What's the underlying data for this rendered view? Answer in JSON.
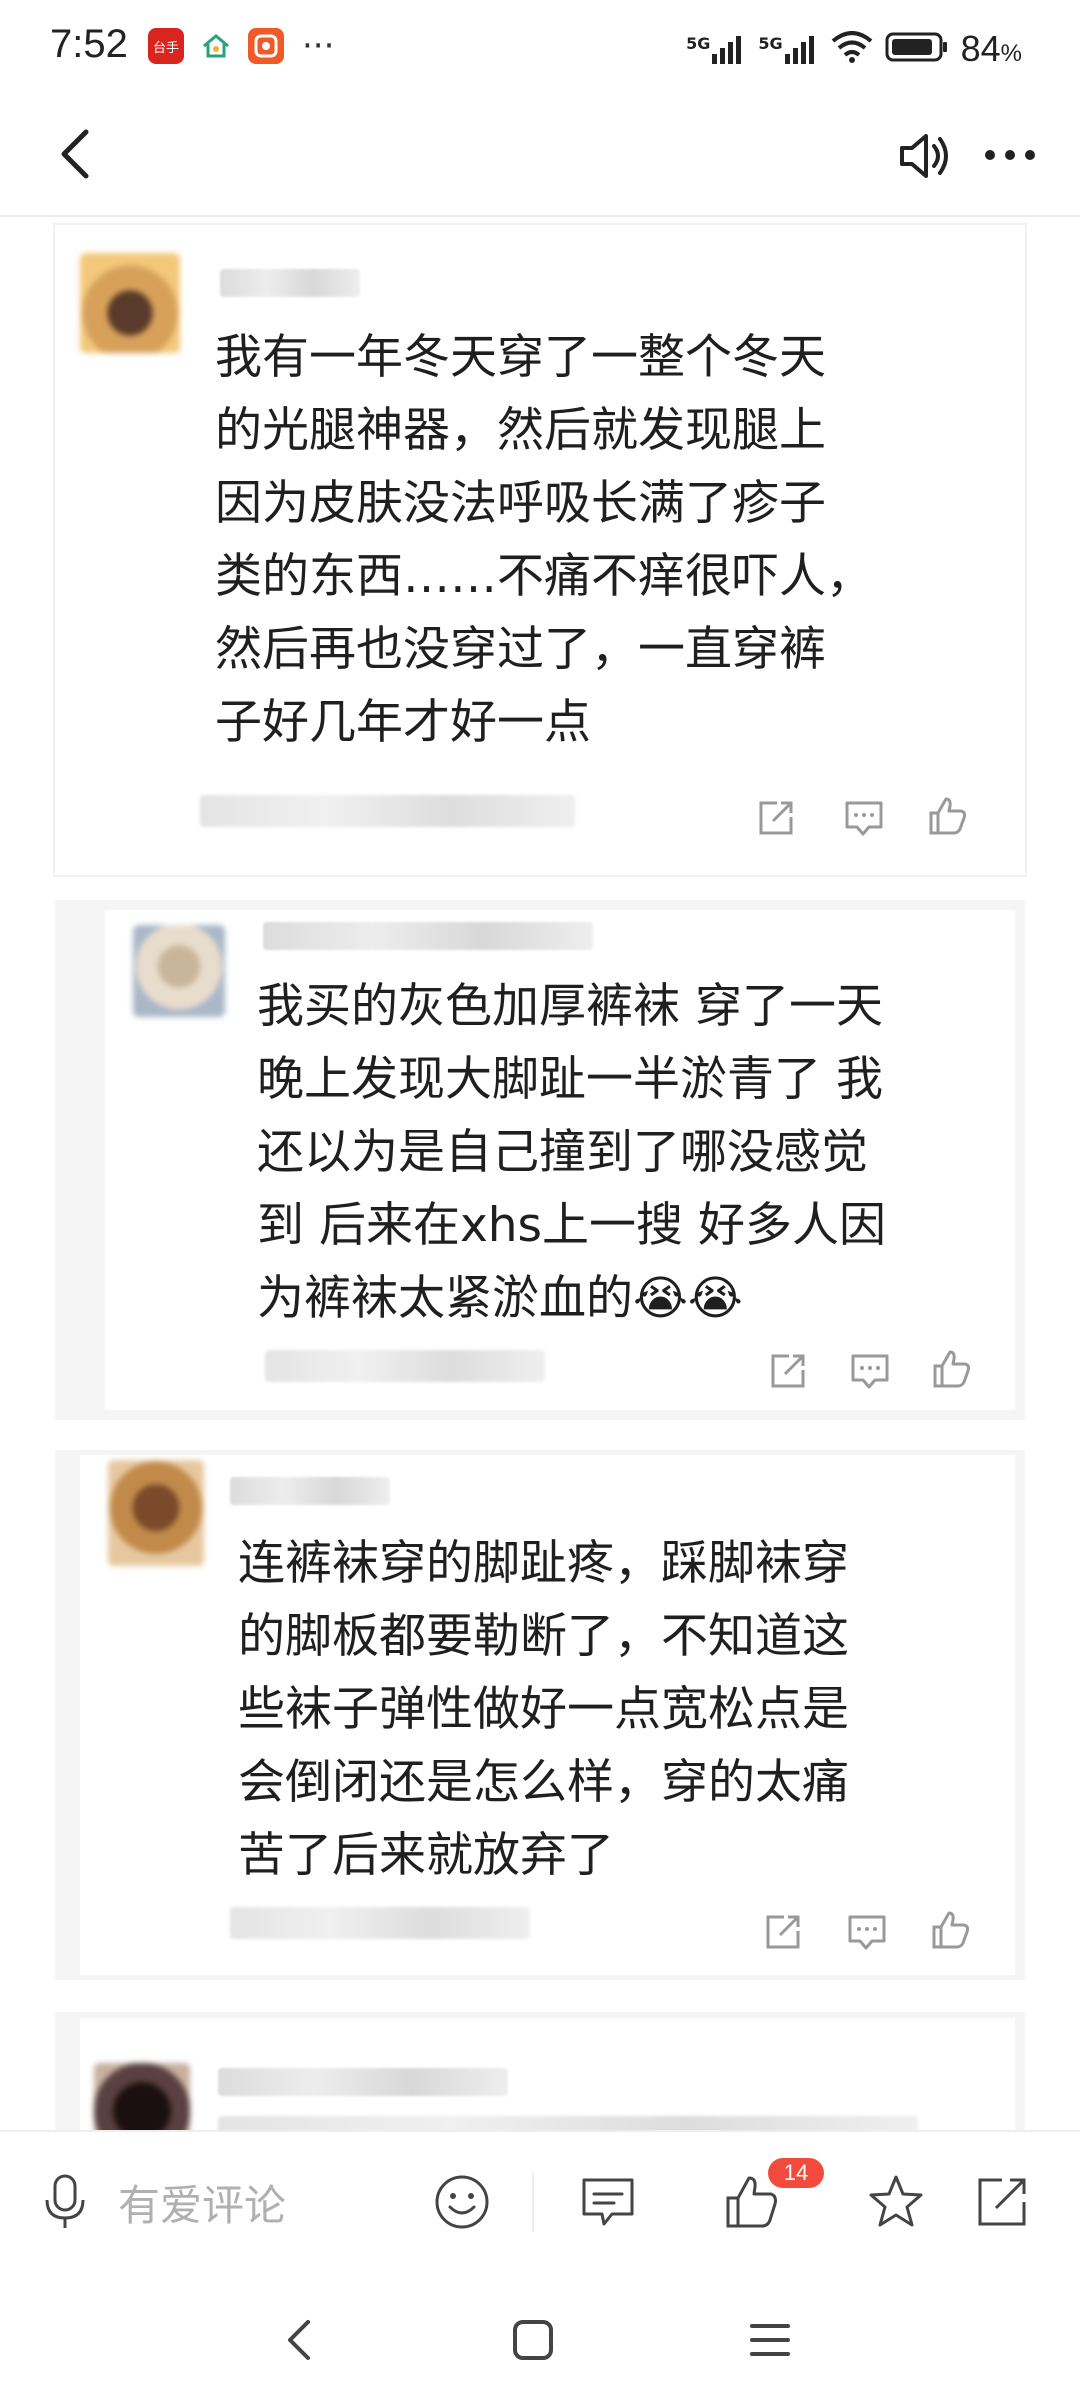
{
  "status": {
    "time": "7:52",
    "apps": [
      {
        "icon": "news-app-icon",
        "color": "#d8251d",
        "text": "台手"
      },
      {
        "icon": "home-app-icon",
        "color": "#ffffff",
        "text": ""
      },
      {
        "icon": "video-app-icon",
        "color": "#f05a28",
        "text": ""
      }
    ],
    "more": "···",
    "network": [
      "5G",
      "5G"
    ],
    "battery_percent": "84",
    "battery_suffix": "%"
  },
  "nav": {
    "back_icon": "back-arrow-icon",
    "speaker_icon": "speaker-icon",
    "more_icon": "more-dots-icon"
  },
  "comments": [
    {
      "text": "我有一年冬天穿了一整个冬天\n的光腿神器，然后就发现腿上\n因为皮肤没法呼吸长满了疹子\n类的东西……不痛不痒很吓人，\n然后再也没穿过了，一直穿裤\n子好几年才好一点"
    },
    {
      "text": "我买的灰色加厚裤袜 穿了一天\n晚上发现大脚趾一半淤青了 我\n还以为是自己撞到了哪没感觉\n到 后来在xhs上一搜 好多人因\n为裤袜太紧淤血的😭😭"
    },
    {
      "text": "连裤袜穿的脚趾疼，踩脚袜穿\n的脚板都要勒断了，不知道这\n些袜子弹性做好一点宽松点是\n会倒闭还是怎么样，穿的太痛\n苦了后来就放弃了"
    }
  ],
  "actions": {
    "share_icon": "share-icon",
    "reply_icon": "comment-icon",
    "like_icon": "thumbs-up-icon"
  },
  "bottom": {
    "placeholder": "有爱评论",
    "like_count": "14"
  }
}
